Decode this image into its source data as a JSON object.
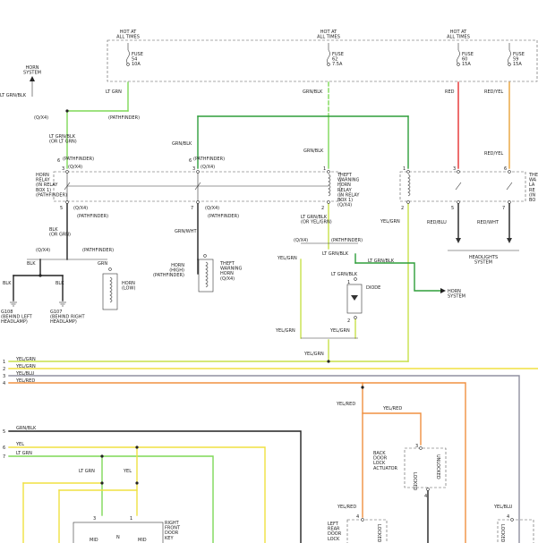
{
  "colors": {
    "grn": "#2e9e3a",
    "lt_grn": "#7ed957",
    "red": "#e53030",
    "red_yel": "#e8a23a",
    "yel": "#f0e040",
    "yel_grn": "#c8e04a",
    "yel_red": "#f09040",
    "yel_blu": "#9090a0",
    "blk": "#222222",
    "wht": "#888888"
  },
  "top": {
    "hot1": "HOT AT\nALL TIMES",
    "hot2": "HOT AT\nALL TIMES",
    "hot3": "HOT AT\nALL TIMES",
    "fuse54": "FUSE\n54\n10A",
    "fuse62": "FUSE\n62\n7.5A",
    "fuse60": "FUSE\n60\n15A",
    "fuse59": "FUSE\n59\n15A"
  },
  "labels": {
    "horn_system_top": "HORN\nSYSTEM",
    "lt_grn_blk_left": "LT GRN/BLK",
    "lt_grn_fuse": "LT GRN",
    "grn_blk_fuse": "GRN/BLK",
    "red": "RED",
    "red_yel": "RED/YEL",
    "x4_1": "(Q/X4)",
    "pathfinder_1": "(PATHFINDER)",
    "lt_grn_blk_or": "LT GRN/BLK\n(OR LT GRN)",
    "grn_blk_2": "GRN/BLK",
    "grn_blk_3": "GRN/BLK",
    "red_yel_2": "RED/YEL",
    "horn_relay": "HORN\nRELAY\n(IN RELAY\nBOX 1)\n(PATHFINDER)",
    "theft_relay": "THEFT\nWARNING\nHORN\nRELAY\n(IN RELAY\nBOX 1)\n(Q/X4)",
    "right_box": "THE\nWA\nLA\nRE\n(IN\nBO",
    "pin6_path": "(PATHFINDER)",
    "pin3_x4": "(Q/X4)",
    "pin6_b_path": "(PATHFINDER)",
    "pin3_b_x4": "(Q/X4)",
    "pin5_x4": "(Q/X4)",
    "pin7_path": "(PATHFINDER)",
    "pin7_x4": "(Q/X4)",
    "pin5_path": "(PATHFINDER)",
    "lt_grn_blk_ye": "LT GRN/BLK\n(OR YEL/GRN)",
    "blk_or_grn": "BLK\n(OR GRN)",
    "grn_wht": "GRN/WHT",
    "yel_grn_relay": "YEL/GRN",
    "red_blu": "RED/BLU",
    "red_wht": "RED/WHT",
    "headlights": "HEADLIGHTS\nSYSTEM",
    "x4_a": "(Q/X4)",
    "pathfinder_a": "(PATHFINDER)",
    "blk_a": "BLK",
    "grn_a": "GRN",
    "blk_b": "BLK",
    "blk_c": "BLK",
    "horn_low": "HORN\n(LOW)",
    "horn_high": "HORN\n(HIGH)\n(PATHFINDER)",
    "theft_horn": "THEFT\nWARNING\nHORN\n(Q/X4)",
    "g108": "G108\n(BEHIND LEFT\nHEADLAMP)",
    "g107": "G107\n(BEHIND RIGHT\nHEADLAMP)",
    "x4_b": "(Q/X4)",
    "pathfinder_b": "(PATHFINDER)",
    "yel_grn_l": "YEL/GRN",
    "lt_grn_blk_d1": "LT GRN/BLK",
    "lt_grn_blk_d2": "LT GRN/BLK",
    "lt_grn_blk_d3": "LT GRN/BLK",
    "diode": "DIODE",
    "horn_system_mid": "HORN\nSYSTEM",
    "yel_grn_m1": "YEL/GRN",
    "yel_grn_m2": "YEL/GRN",
    "yel_grn_m3": "YEL/GRN",
    "bus1": "YEL/GRN",
    "bus2": "YEL/GRN",
    "bus3": "YEL/BLU",
    "bus4": "YEL/RED",
    "n1": "1",
    "n2": "2",
    "n3": "3",
    "n4": "4",
    "n5": "5",
    "n6": "6",
    "n7": "7",
    "grn_blk_low": "GRN/BLK",
    "yel_low": "YEL",
    "lt_grn_low": "LT GRN",
    "lt_grn_low2": "LT GRN",
    "yel_low2": "YEL",
    "yel_red_a": "YEL/RED",
    "yel_red_b": "YEL/RED",
    "yel_red_c": "YEL/RED",
    "yel_blu_r": "YEL/BLU",
    "back_door": "BACK\nDOOR\nLOCK\nACTUATOR",
    "locked": "LOCKED",
    "unlocked": "UNLOCKED",
    "right_front": "RIGHT\nFRONT\nDOOR\nKEY",
    "left_rear": "LEFT\nREAR\nDOOR\nLOCK",
    "locked2": "LOCKED",
    "locked3": "LOCKED",
    "n_mid": "N",
    "mid1": "MID",
    "mid2": "MID"
  }
}
